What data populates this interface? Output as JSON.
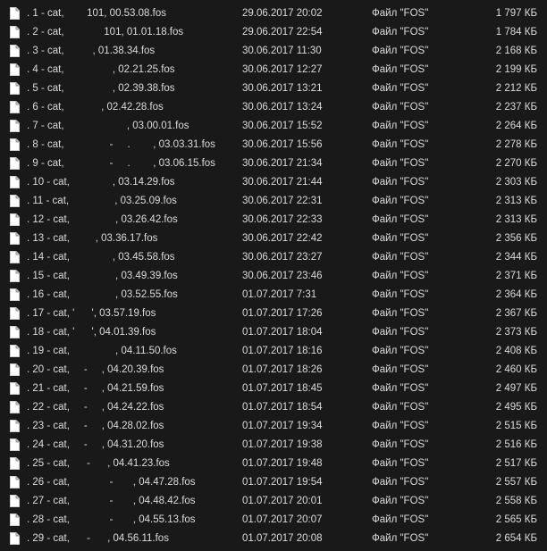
{
  "files": [
    {
      "name": ". 1 - cat,        101, 00.53.08.fos",
      "date": "29.06.2017 20:02",
      "type": "Файл \"FOS\"",
      "size": "1 797 КБ"
    },
    {
      "name": ". 2 - cat,              101, 01.01.18.fos",
      "date": "29.06.2017 22:54",
      "type": "Файл \"FOS\"",
      "size": "1 784 КБ"
    },
    {
      "name": ". 3 - cat,          , 01.38.34.fos",
      "date": "30.06.2017 11:30",
      "type": "Файл \"FOS\"",
      "size": "2 168 КБ"
    },
    {
      "name": ". 4 - cat,                 , 02.21.25.fos",
      "date": "30.06.2017 12:27",
      "type": "Файл \"FOS\"",
      "size": "2 199 КБ"
    },
    {
      "name": ". 5 - cat,                 , 02.39.38.fos",
      "date": "30.06.2017 13:21",
      "type": "Файл \"FOS\"",
      "size": "2 212 КБ"
    },
    {
      "name": ". 6 - cat,             , 02.42.28.fos",
      "date": "30.06.2017 13:24",
      "type": "Файл \"FOS\"",
      "size": "2 237 КБ"
    },
    {
      "name": ". 7 - cat,                      , 03.00.01.fos",
      "date": "30.06.2017 15:52",
      "type": "Файл \"FOS\"",
      "size": "2 264 КБ"
    },
    {
      "name": ". 8 - cat,                -     .        , 03.03.31.fos",
      "date": "30.06.2017 15:56",
      "type": "Файл \"FOS\"",
      "size": "2 278 КБ"
    },
    {
      "name": ". 9 - cat,                -     .        , 03.06.15.fos",
      "date": "30.06.2017 21:34",
      "type": "Файл \"FOS\"",
      "size": "2 270 КБ"
    },
    {
      "name": ". 10 - cat,               , 03.14.29.fos",
      "date": "30.06.2017 21:44",
      "type": "Файл \"FOS\"",
      "size": "2 303 КБ"
    },
    {
      "name": ". 11 - cat,                , 03.25.09.fos",
      "date": "30.06.2017 22:31",
      "type": "Файл \"FOS\"",
      "size": "2 313 КБ"
    },
    {
      "name": ". 12 - cat,                , 03.26.42.fos",
      "date": "30.06.2017 22:33",
      "type": "Файл \"FOS\"",
      "size": "2 313 КБ"
    },
    {
      "name": ". 13 - cat,         , 03.36.17.fos",
      "date": "30.06.2017 22:42",
      "type": "Файл \"FOS\"",
      "size": "2 356 КБ"
    },
    {
      "name": ". 14 - cat,               , 03.45.58.fos",
      "date": "30.06.2017 23:27",
      "type": "Файл \"FOS\"",
      "size": "2 344 КБ"
    },
    {
      "name": ". 15 - cat,                , 03.49.39.fos",
      "date": "30.06.2017 23:46",
      "type": "Файл \"FOS\"",
      "size": "2 371 КБ"
    },
    {
      "name": ". 16 - cat,                , 03.52.55.fos",
      "date": "01.07.2017 7:31",
      "type": "Файл \"FOS\"",
      "size": "2 364 КБ"
    },
    {
      "name": ". 17 - cat, '      ', 03.57.19.fos",
      "date": "01.07.2017 17:26",
      "type": "Файл \"FOS\"",
      "size": "2 367 КБ"
    },
    {
      "name": ". 18 - cat, '      ', 04.01.39.fos",
      "date": "01.07.2017 18:04",
      "type": "Файл \"FOS\"",
      "size": "2 373 КБ"
    },
    {
      "name": ". 19 - cat,                , 04.11.50.fos",
      "date": "01.07.2017 18:16",
      "type": "Файл \"FOS\"",
      "size": "2 408 КБ"
    },
    {
      "name": ". 20 - cat,     -     , 04.20.39.fos",
      "date": "01.07.2017 18:26",
      "type": "Файл \"FOS\"",
      "size": "2 460 КБ"
    },
    {
      "name": ". 21 - cat,     -     , 04.21.59.fos",
      "date": "01.07.2017 18:45",
      "type": "Файл \"FOS\"",
      "size": "2 497 КБ"
    },
    {
      "name": ". 22 - cat,     -     , 04.24.22.fos",
      "date": "01.07.2017 18:54",
      "type": "Файл \"FOS\"",
      "size": "2 495 КБ"
    },
    {
      "name": ". 23 - cat,     -     , 04.28.02.fos",
      "date": "01.07.2017 19:34",
      "type": "Файл \"FOS\"",
      "size": "2 515 КБ"
    },
    {
      "name": ". 24 - cat,     -     , 04.31.20.fos",
      "date": "01.07.2017 19:38",
      "type": "Файл \"FOS\"",
      "size": "2 516 КБ"
    },
    {
      "name": ". 25 - cat,      -      , 04.41.23.fos",
      "date": "01.07.2017 19:48",
      "type": "Файл \"FOS\"",
      "size": "2 517 КБ"
    },
    {
      "name": ". 26 - cat,              -       , 04.47.28.fos",
      "date": "01.07.2017 19:54",
      "type": "Файл \"FOS\"",
      "size": "2 557 КБ"
    },
    {
      "name": ". 27 - cat,              -       , 04.48.42.fos",
      "date": "01.07.2017 20:01",
      "type": "Файл \"FOS\"",
      "size": "2 558 КБ"
    },
    {
      "name": ". 28 - cat,              -       , 04.55.13.fos",
      "date": "01.07.2017 20:07",
      "type": "Файл \"FOS\"",
      "size": "2 565 КБ"
    },
    {
      "name": ". 29 - cat,      -      , 04.56.11.fos",
      "date": "01.07.2017 20:08",
      "type": "Файл \"FOS\"",
      "size": "2 654 КБ"
    }
  ],
  "icon": "file-icon",
  "colors": {
    "background": "#191919",
    "text": "#dcdcdc",
    "icon_fill": "#ffffff",
    "icon_fold": "#bdbdbd"
  }
}
